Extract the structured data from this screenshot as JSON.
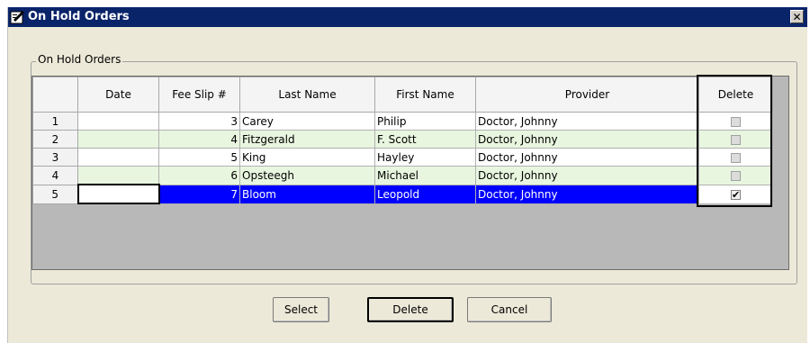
{
  "window": {
    "title": "On Hold Orders",
    "close_glyph": "✕"
  },
  "group": {
    "label": "On Hold Orders"
  },
  "grid": {
    "columns": [
      "",
      "Date",
      "Fee Slip #",
      "Last Name",
      "First Name",
      "Provider",
      "Delete"
    ],
    "rows": [
      {
        "num": "1",
        "date": "",
        "fee_slip": "3",
        "last": "Carey",
        "first": "Philip",
        "provider": "Doctor, Johnny",
        "delete": false
      },
      {
        "num": "2",
        "date": "",
        "fee_slip": "4",
        "last": "Fitzgerald",
        "first": "F. Scott",
        "provider": "Doctor, Johnny",
        "delete": false
      },
      {
        "num": "3",
        "date": "",
        "fee_slip": "5",
        "last": "King",
        "first": "Hayley",
        "provider": "Doctor, Johnny",
        "delete": false
      },
      {
        "num": "4",
        "date": "",
        "fee_slip": "6",
        "last": "Opsteegh",
        "first": "Michael",
        "provider": "Doctor, Johnny",
        "delete": false
      },
      {
        "num": "5",
        "date": "",
        "fee_slip": "7",
        "last": "Bloom",
        "first": "Leopold",
        "provider": "Doctor, Johnny",
        "delete": true
      }
    ],
    "selected_row": 4
  },
  "buttons": {
    "select": "Select",
    "delete": "Delete",
    "cancel": "Cancel"
  },
  "colors": {
    "titlebar": "#0a246a",
    "selected_row": "#0000ff",
    "alt_row": "#e8f6df"
  }
}
